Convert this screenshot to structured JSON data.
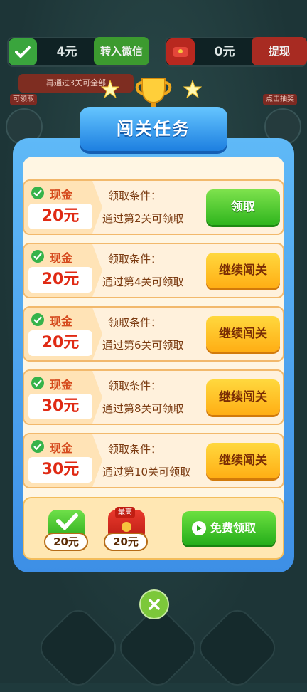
{
  "topbar": {
    "balance_amount": "4元",
    "transfer_label": "转入微信",
    "cash_amount": "0元",
    "withdraw_label": "提现"
  },
  "hint": "再通过3关可全部",
  "side": {
    "left_tag": "可领取",
    "right_tag": "点击抽奖"
  },
  "modal": {
    "title": "闯关任务",
    "tasks": [
      {
        "tag": "现金",
        "reward": "20元",
        "cond_title": "领取条件：",
        "cond_text": "通过第2关可领取",
        "button": "领取",
        "button_style": "green"
      },
      {
        "tag": "现金",
        "reward": "20元",
        "cond_title": "领取条件：",
        "cond_text": "通过第4关可领取",
        "button": "继续闯关",
        "button_style": "gold"
      },
      {
        "tag": "现金",
        "reward": "20元",
        "cond_title": "领取条件：",
        "cond_text": "通过第6关可领取",
        "button": "继续闯关",
        "button_style": "gold"
      },
      {
        "tag": "现金",
        "reward": "30元",
        "cond_title": "领取条件：",
        "cond_text": "通过第8关可领取",
        "button": "继续闯关",
        "button_style": "gold"
      },
      {
        "tag": "现金",
        "reward": "30元",
        "cond_title": "领取条件：",
        "cond_text": "通过第10关可领取",
        "button": "继续闯关",
        "button_style": "gold"
      }
    ],
    "footer": {
      "check_amount": "20元",
      "redpacket_badge": "最高",
      "redpacket_amount": "20元",
      "free_button": "免费领取"
    }
  },
  "colors": {
    "modal_blue": "#3d8fe6",
    "green_button": "#2fb51d",
    "gold_button": "#ffae14",
    "reward_red": "#e02a14"
  }
}
